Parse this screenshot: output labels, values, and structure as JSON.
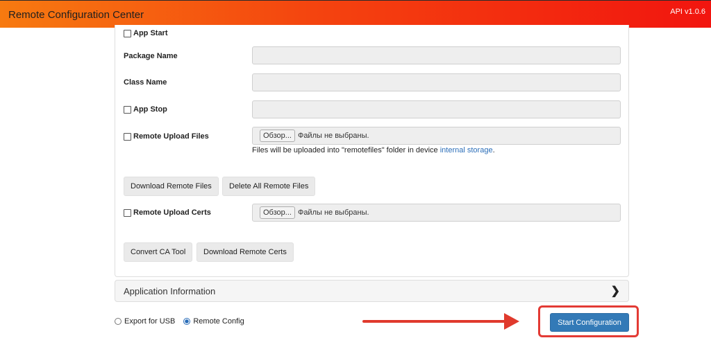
{
  "header": {
    "title": "Remote Configuration Center",
    "api_version": "API v1.0.6"
  },
  "form": {
    "app_start_label": "App Start",
    "package_name_label": "Package Name",
    "package_name_value": "",
    "class_name_label": "Class Name",
    "class_name_value": "",
    "app_stop_label": "App Stop",
    "app_stop_value": "",
    "remote_upload_files_label": "Remote Upload Files",
    "upload_files": {
      "browse_label": "Обзор...",
      "status": "Файлы не выбраны."
    },
    "upload_hint_text": "Files will be uploaded into \"remotefiles\" folder in device ",
    "upload_hint_link": "internal storage",
    "upload_hint_end": ".",
    "download_remote_files_button": "Download Remote Files",
    "delete_all_remote_files_button": "Delete All Remote Files",
    "remote_upload_certs_label": "Remote Upload Certs",
    "upload_certs": {
      "browse_label": "Обзор...",
      "status": "Файлы не выбраны."
    },
    "convert_ca_tool_button": "Convert CA Tool",
    "download_remote_certs_button": "Download Remote Certs"
  },
  "accordion": {
    "title": "Application Information",
    "chevron_icon": "chevron-right-icon"
  },
  "mode": {
    "options": [
      {
        "label": "Export for USB",
        "checked": false
      },
      {
        "label": "Remote Config",
        "checked": true
      }
    ]
  },
  "actions": {
    "start_button": "Start Configuration"
  },
  "colors": {
    "topbar_start": "#f77a10",
    "topbar_end": "#f2150f",
    "primary_button": "#337ab7",
    "link": "#2a6db8",
    "annotation_red": "#e03a2d"
  }
}
